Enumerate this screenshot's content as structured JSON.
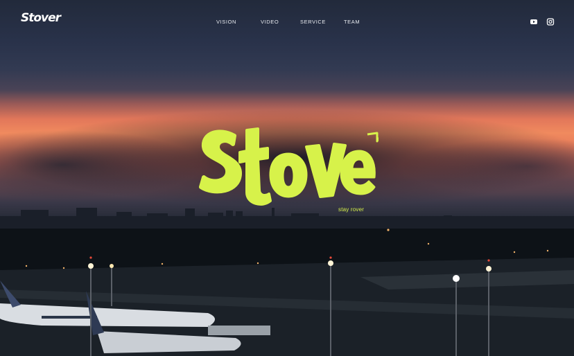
{
  "header": {
    "logo_text": "Stover",
    "nav": [
      {
        "label": "VISION"
      },
      {
        "label": "VIDEO"
      },
      {
        "label": "SERVICE"
      },
      {
        "label": "TEAM"
      }
    ],
    "social": [
      {
        "icon": "youtube-icon"
      },
      {
        "icon": "instagram-icon"
      }
    ]
  },
  "hero": {
    "brand": "Stover",
    "tagline": "stay rover"
  },
  "colors": {
    "brand_accent": "#d7f24a",
    "nav_text": "#e8ebf0"
  }
}
